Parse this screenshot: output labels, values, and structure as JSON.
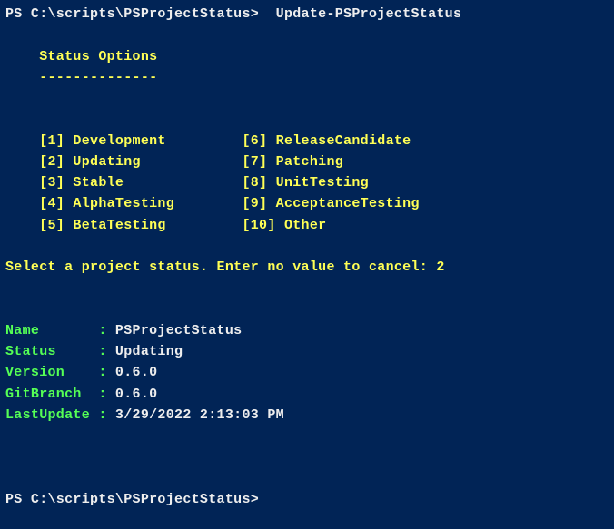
{
  "prompt1_full": "PS C:\\scripts\\PSProjectStatus>  Update-PSProjectStatus",
  "header": "    Status Options",
  "underline": "    --------------",
  "opt1": "    [1] Development         [6] ReleaseCandidate",
  "opt2": "    [2] Updating            [7] Patching",
  "opt3": "    [3] Stable              [8] UnitTesting",
  "opt4": "    [4] AlphaTesting        [9] AcceptanceTesting",
  "opt5": "    [5] BetaTesting         [10] Other",
  "select_prompt": "Select a project status. Enter no value to cancel: 2",
  "result_name_label": "Name       : ",
  "result_name_value": "PSProjectStatus",
  "result_status_label": "Status     : ",
  "result_status_value": "Updating",
  "result_version_label": "Version    : ",
  "result_version_value": "0.6.0",
  "result_branch_label": "GitBranch  : ",
  "result_branch_value": "0.6.0",
  "result_update_label": "LastUpdate : ",
  "result_update_value": "3/29/2022 2:13:03 PM",
  "prompt2": "PS C:\\scripts\\PSProjectStatus>"
}
